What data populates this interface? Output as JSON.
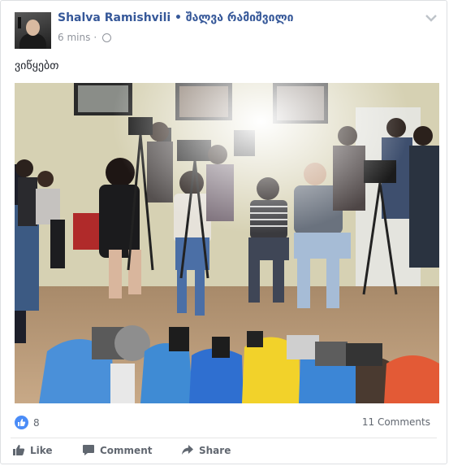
{
  "post": {
    "author": "Shalva Ramishvili • შალვა რამიშვილი",
    "time": "6 mins",
    "text": "ვიწყებთ",
    "reactions_count": "8",
    "comments_count": "11 Comments"
  },
  "actions": {
    "like": "Like",
    "comment": "Comment",
    "share": "Share"
  },
  "colors": {
    "author_link": "#365899",
    "like_blue": "#4a8cf7",
    "meta_grey": "#90949c"
  },
  "icons": [
    "chevron-down-icon",
    "globe-icon",
    "like-icon",
    "thumb-icon",
    "comment-icon",
    "share-icon"
  ]
}
